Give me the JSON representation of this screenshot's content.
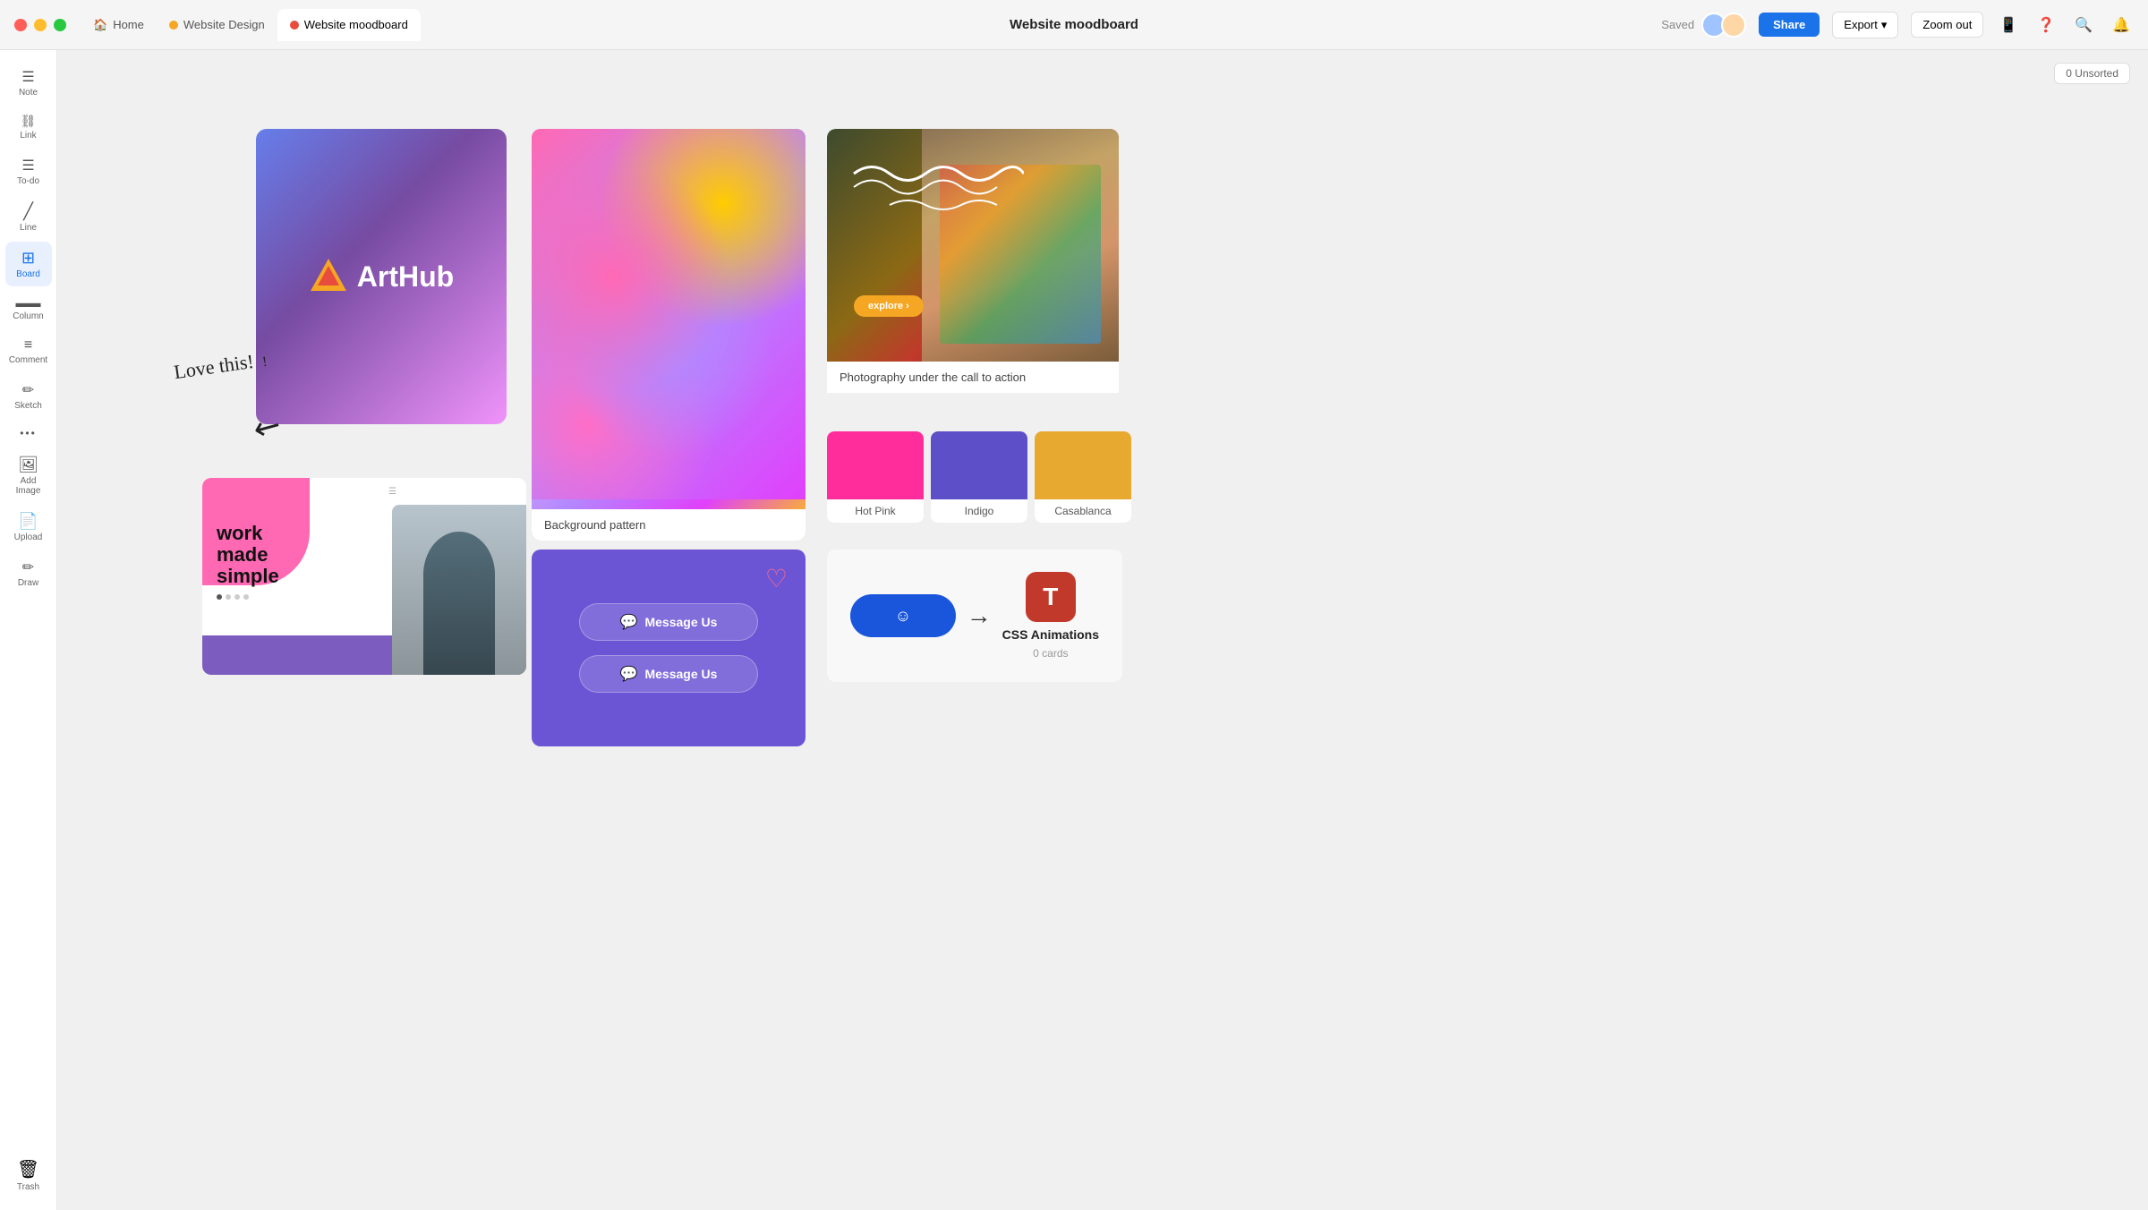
{
  "titlebar": {
    "tabs": [
      {
        "id": "home",
        "label": "Home",
        "dot_color": "#6b6b6b",
        "active": false
      },
      {
        "id": "website-design",
        "label": "Website Design",
        "dot_color": "#f5a623",
        "active": false
      },
      {
        "id": "website-moodboard",
        "label": "Website moodboard",
        "dot_color": "#e74c3c",
        "active": true
      }
    ],
    "title": "Website moodboard",
    "saved_label": "Saved",
    "share_label": "Share",
    "export_label": "Export",
    "export_arrow": "▾",
    "zoom_label": "Zoom out",
    "notification_count": "0"
  },
  "toolbar": {
    "items": [
      {
        "id": "note",
        "icon": "☰",
        "label": "Note"
      },
      {
        "id": "link",
        "icon": "🔗",
        "label": "Link"
      },
      {
        "id": "todo",
        "icon": "≡",
        "label": "To-do"
      },
      {
        "id": "line",
        "icon": "╱",
        "label": "Line"
      },
      {
        "id": "board",
        "icon": "⊞",
        "label": "Board",
        "active": true
      },
      {
        "id": "column",
        "icon": "▬",
        "label": "Column"
      },
      {
        "id": "comment",
        "icon": "≡",
        "label": "Comment"
      },
      {
        "id": "sketch",
        "icon": "✏",
        "label": "Sketch"
      },
      {
        "id": "more",
        "icon": "•••",
        "label": ""
      },
      {
        "id": "add-image",
        "icon": "🖼",
        "label": "Add Image"
      },
      {
        "id": "upload",
        "icon": "📄",
        "label": "Upload"
      },
      {
        "id": "draw",
        "icon": "✏",
        "label": "Draw"
      }
    ],
    "trash_label": "Trash"
  },
  "canvas": {
    "unsorted_label": "0 Unsorted",
    "arthub": {
      "logo_text": "ArtHub"
    },
    "annotation": {
      "text": "Love this!",
      "arrow": "↘"
    },
    "work_card": {
      "text_line1": "work",
      "text_line2": "made",
      "text_line3": "simple"
    },
    "bg_pattern": {
      "label": "Background pattern"
    },
    "photo": {
      "label": "Photography under the call to action"
    },
    "swatches": [
      {
        "id": "hot-pink",
        "color": "#ff2d9b",
        "label": "Hot Pink"
      },
      {
        "id": "indigo",
        "color": "#5c4fc7",
        "label": "Indigo"
      },
      {
        "id": "casablanca",
        "color": "#e8a930",
        "label": "Casablanca"
      }
    ],
    "messages": [
      {
        "label": "Message Us"
      },
      {
        "label": "Message Us"
      }
    ],
    "css_animations": {
      "title": "CSS Animations",
      "subtitle": "0 cards",
      "t_icon": "T"
    }
  }
}
